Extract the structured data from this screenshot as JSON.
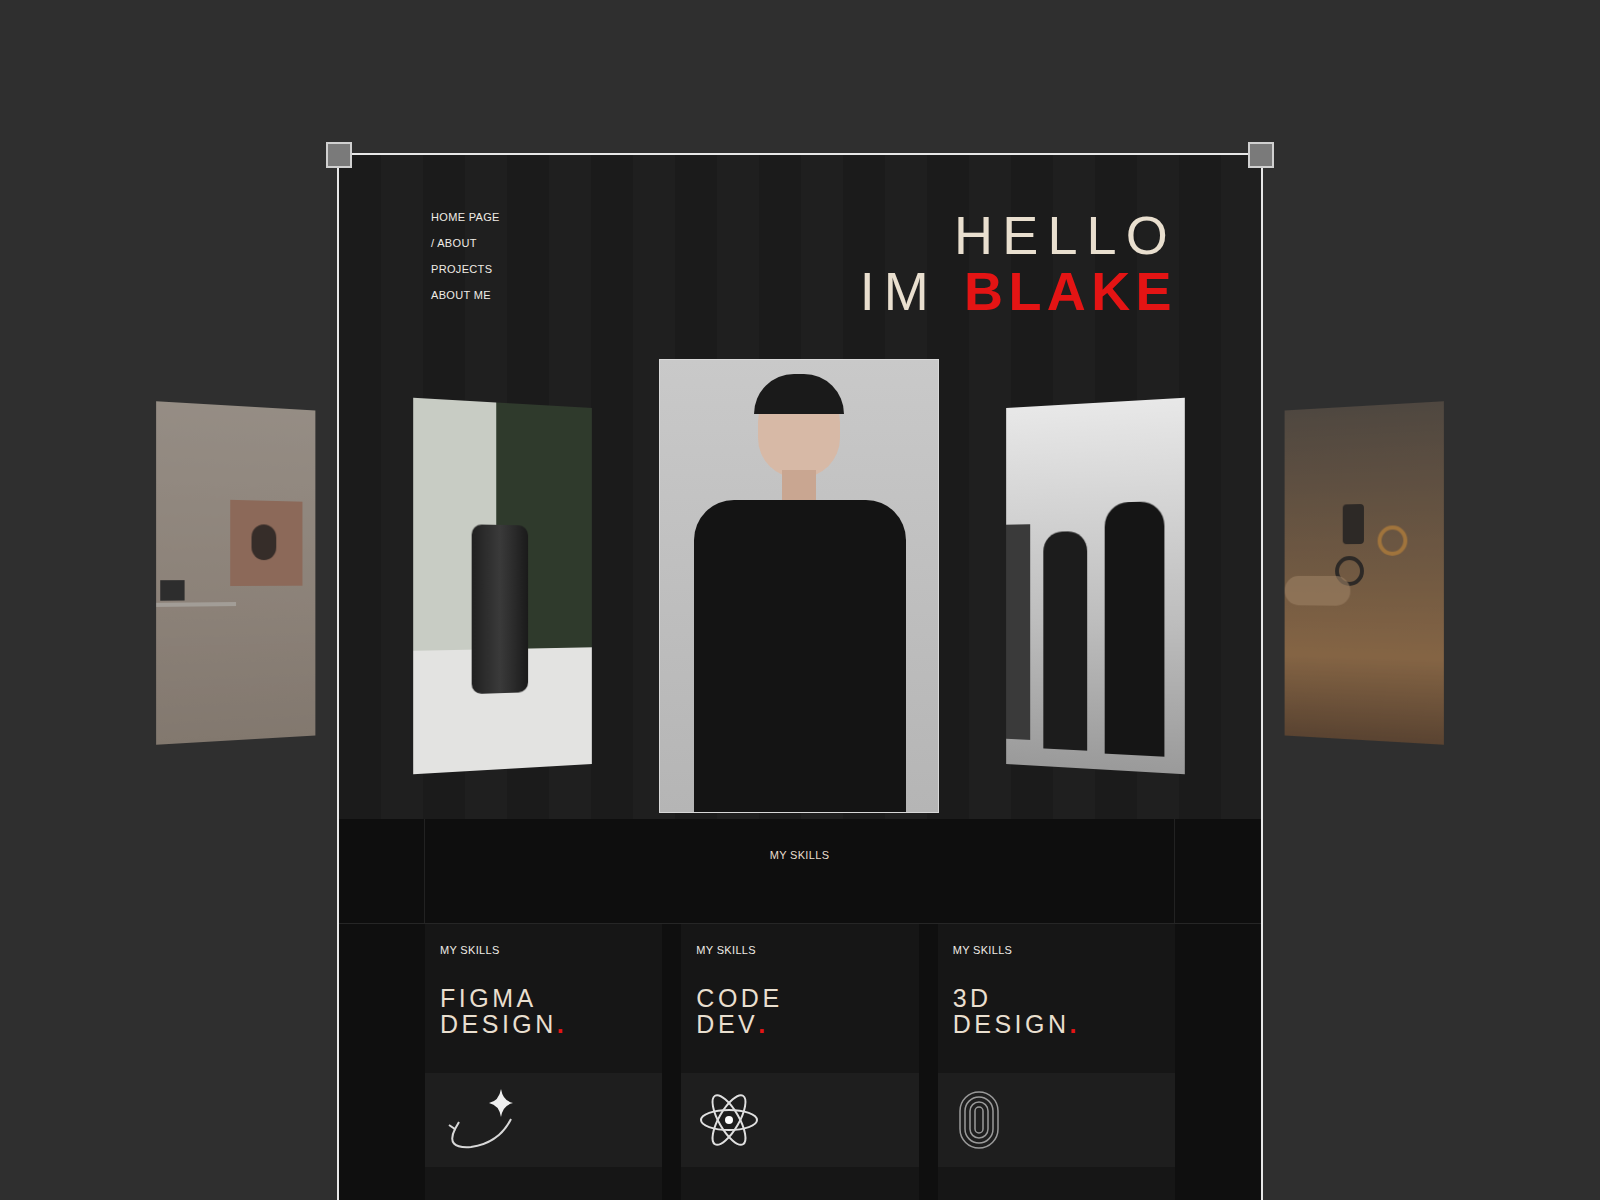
{
  "nav": [
    {
      "label": "HOME PAGE"
    },
    {
      "label": "/ ABOUT"
    },
    {
      "label": "PROJECTS"
    },
    {
      "label": "ABOUT ME"
    }
  ],
  "hero": {
    "greeting": "HELLO",
    "prefix": "IM",
    "name": "BLAKE"
  },
  "skills_band": {
    "label": "MY SKILLS"
  },
  "skills": [
    {
      "label": "MY SKILLS",
      "title": [
        "FIGMA",
        "DESIGN"
      ],
      "dot": ".",
      "kind": "figma"
    },
    {
      "label": "MY SKILLS",
      "title": [
        "CODE",
        "DEV"
      ],
      "dot": ".",
      "kind": "code"
    },
    {
      "label": "MY SKILLS",
      "title": [
        "3D",
        "DESIGN"
      ],
      "dot": ".",
      "kind": "3d"
    }
  ]
}
